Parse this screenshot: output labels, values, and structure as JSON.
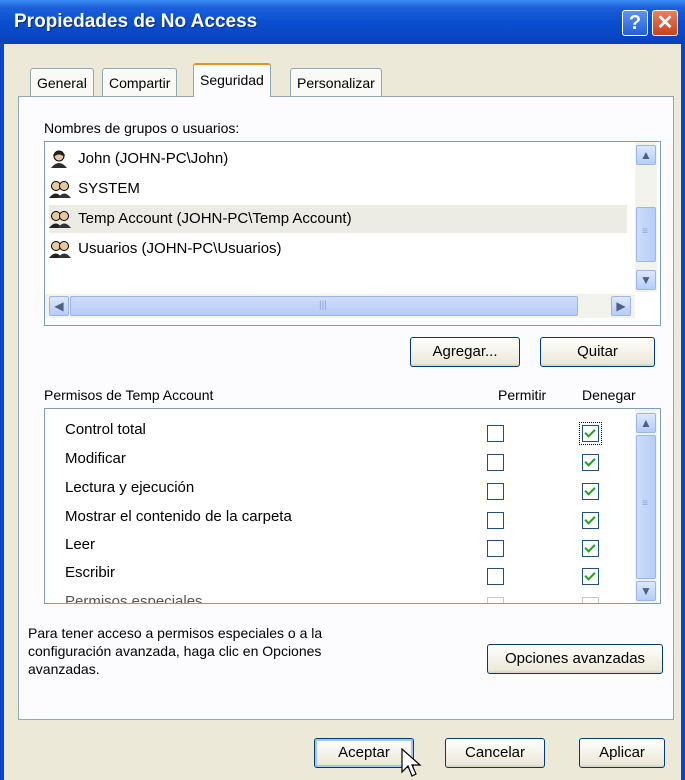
{
  "window": {
    "title": "Propiedades de No Access",
    "help_glyph": "?",
    "close_glyph": "✕"
  },
  "tabs": [
    {
      "label": "General",
      "active": false
    },
    {
      "label": "Compartir",
      "active": false
    },
    {
      "label": "Seguridad",
      "active": true
    },
    {
      "label": "Personalizar",
      "active": false
    }
  ],
  "groups": {
    "label": "Nombres de grupos o usuarios:",
    "items": [
      {
        "name": "John (JOHN-PC\\John)",
        "icon": "user-icon",
        "selected": false
      },
      {
        "name": "SYSTEM",
        "icon": "group-icon",
        "selected": false
      },
      {
        "name": "Temp Account (JOHN-PC\\Temp Account)",
        "icon": "group-icon",
        "selected": true
      },
      {
        "name": "Usuarios (JOHN-PC\\Usuarios)",
        "icon": "group-icon",
        "selected": false
      }
    ],
    "add_label": "Agregar...",
    "remove_label": "Quitar"
  },
  "permissions": {
    "label": "Permisos de Temp Account",
    "allow_header": "Permitir",
    "deny_header": "Denegar",
    "rows": [
      {
        "name": "Control total",
        "allow": false,
        "deny": true
      },
      {
        "name": "Modificar",
        "allow": false,
        "deny": true
      },
      {
        "name": "Lectura y ejecución",
        "allow": false,
        "deny": true
      },
      {
        "name": "Mostrar el contenido de la carpeta",
        "allow": false,
        "deny": true
      },
      {
        "name": "Leer",
        "allow": false,
        "deny": true
      },
      {
        "name": "Escribir",
        "allow": false,
        "deny": true
      },
      {
        "name": "Permisos especiales",
        "allow": false,
        "deny": false
      }
    ]
  },
  "advanced": {
    "info": "Para tener acceso a permisos especiales o a la configuración avanzada, haga clic en Opciones avanzadas.",
    "button_label": "Opciones avanzadas"
  },
  "footer": {
    "ok_label": "Aceptar",
    "cancel_label": "Cancelar",
    "apply_label": "Aplicar"
  },
  "colors": {
    "title_bar": "#0a4fd0",
    "dialog_bg": "#ece9d8",
    "selection": "#ecebe4",
    "check": "#21a121"
  }
}
